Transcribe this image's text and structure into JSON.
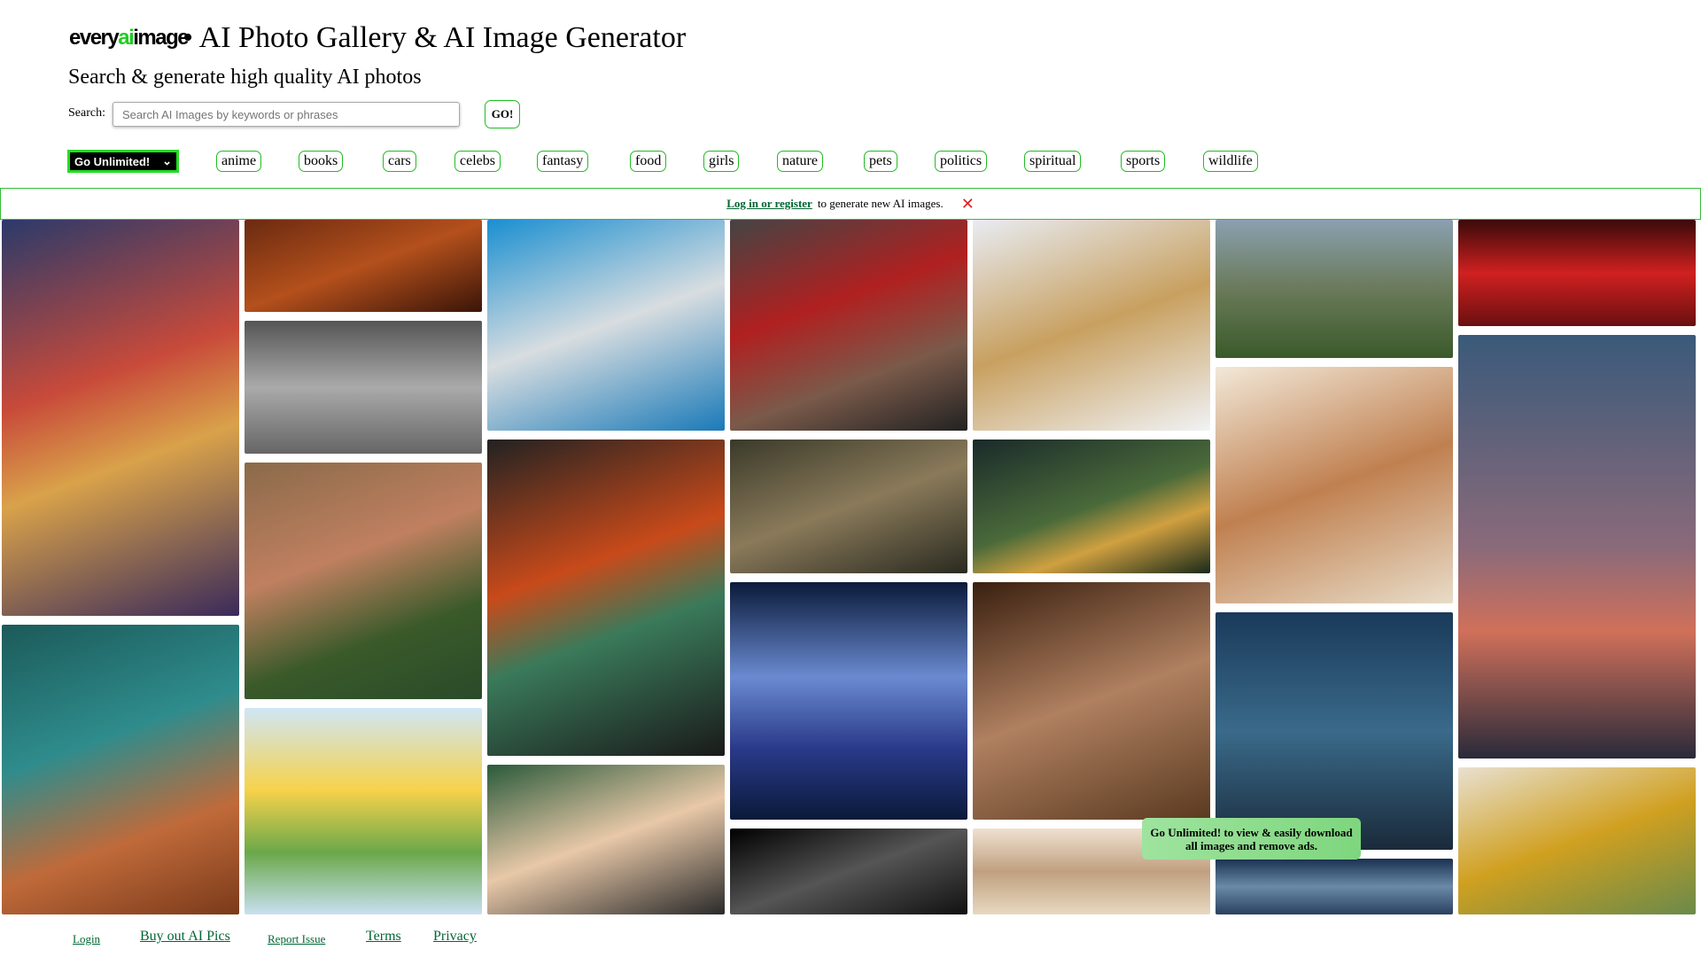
{
  "header": {
    "logo_pre": "every",
    "logo_ai": "ai",
    "logo_post": "image",
    "title": " • AI Photo Gallery & AI Image Generator",
    "subtitle": "Search & generate high quality AI photos"
  },
  "search": {
    "label": "Search:",
    "placeholder": "Search AI Images by keywords or phrases",
    "button": "GO!"
  },
  "go_unlimited_select": "Go Unlimited!",
  "tags": [
    "anime",
    "books",
    "cars",
    "celebs",
    "fantasy",
    "food",
    "girls",
    "nature",
    "pets",
    "politics",
    "spiritual",
    "sports",
    "wildlife"
  ],
  "banner": {
    "link": "Log in or register",
    "text": "to generate new AI images."
  },
  "ad_overlay": "Go Unlimited! to view & easily download all images and remove ads.",
  "footer": [
    "Login",
    "Buy out AI Pics",
    "Report Issue",
    "Terms",
    "Privacy"
  ],
  "colors": {
    "accent": "#22bb22",
    "link": "#006633",
    "close": "#dd2222"
  }
}
